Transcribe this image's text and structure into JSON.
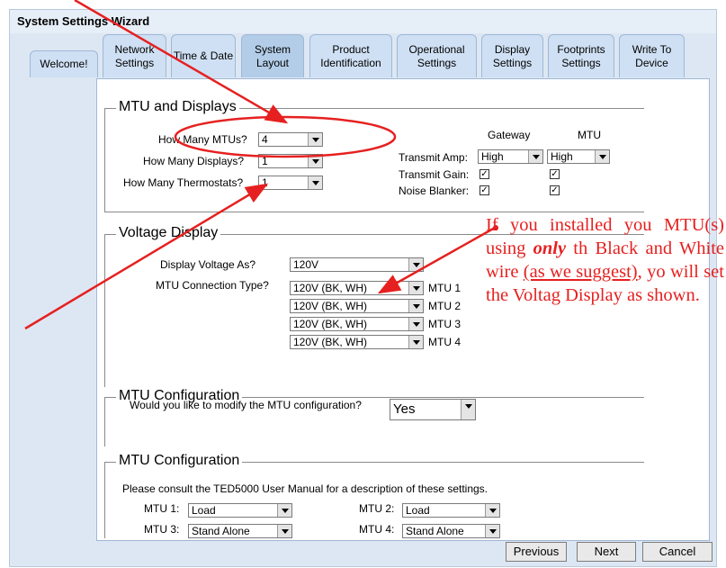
{
  "window": {
    "title": "System Settings Wizard"
  },
  "tabs": [
    {
      "label": "Welcome!"
    },
    {
      "label": "Network Settings"
    },
    {
      "label": "Time & Date"
    },
    {
      "label": "System Layout"
    },
    {
      "label": "Product Identification"
    },
    {
      "label": "Operational Settings"
    },
    {
      "label": "Display Settings"
    },
    {
      "label": "Footprints Settings"
    },
    {
      "label": "Write To Device"
    }
  ],
  "mtu_displays": {
    "legend": "MTU and Displays",
    "how_many_mtus_label": "How Many MTUs?",
    "how_many_mtus_value": "4",
    "how_many_displays_label": "How Many Displays?",
    "how_many_displays_value": "1",
    "how_many_thermostats_label": "How Many Thermostats?",
    "how_many_thermostats_value": "1",
    "gateway_header": "Gateway",
    "mtu_header": "MTU",
    "transmit_amp_label": "Transmit Amp:",
    "transmit_amp_gateway": "High",
    "transmit_amp_mtu": "High",
    "transmit_gain_label": "Transmit Gain:",
    "noise_blanker_label": "Noise Blanker:",
    "check_mark": "✓"
  },
  "voltage_display": {
    "legend": "Voltage Display",
    "display_voltage_label": "Display Voltage As?",
    "display_voltage_value": "120V",
    "connection_type_label": "MTU Connection Type?",
    "rows": [
      {
        "value": "120V (BK, WH)",
        "label": "MTU 1"
      },
      {
        "value": "120V (BK, WH)",
        "label": "MTU 2"
      },
      {
        "value": "120V (BK, WH)",
        "label": "MTU 3"
      },
      {
        "value": "120V (BK, WH)",
        "label": "MTU 4"
      }
    ]
  },
  "mtu_config_1": {
    "legend": "MTU Configuration",
    "question": "Would you like to modify the MTU configuration?",
    "value": "Yes"
  },
  "mtu_config_2": {
    "legend": "MTU Configuration",
    "note": "Please consult the TED5000 User Manual for a description of these settings.",
    "mtu1_label": "MTU 1:",
    "mtu1_value": "Load",
    "mtu2_label": "MTU 2:",
    "mtu2_value": "Load",
    "mtu3_label": "MTU 3:",
    "mtu3_value": "Stand Alone",
    "mtu4_label": "MTU 4:",
    "mtu4_value": "Stand Alone"
  },
  "buttons": {
    "previous": "Previous",
    "next": "Next",
    "cancel": "Cancel"
  },
  "annotation": {
    "text_1": "If you installed you MTU(s) using ",
    "text_only": "only",
    "text_2": " th Black and White wire ",
    "text_suggest": "(as we suggest)",
    "text_3": ", yo will set the Voltag Display as shown."
  },
  "colors": {
    "annotation": "#e62020",
    "tab_active": "#b3cde8",
    "tab": "#cfe0f4"
  }
}
